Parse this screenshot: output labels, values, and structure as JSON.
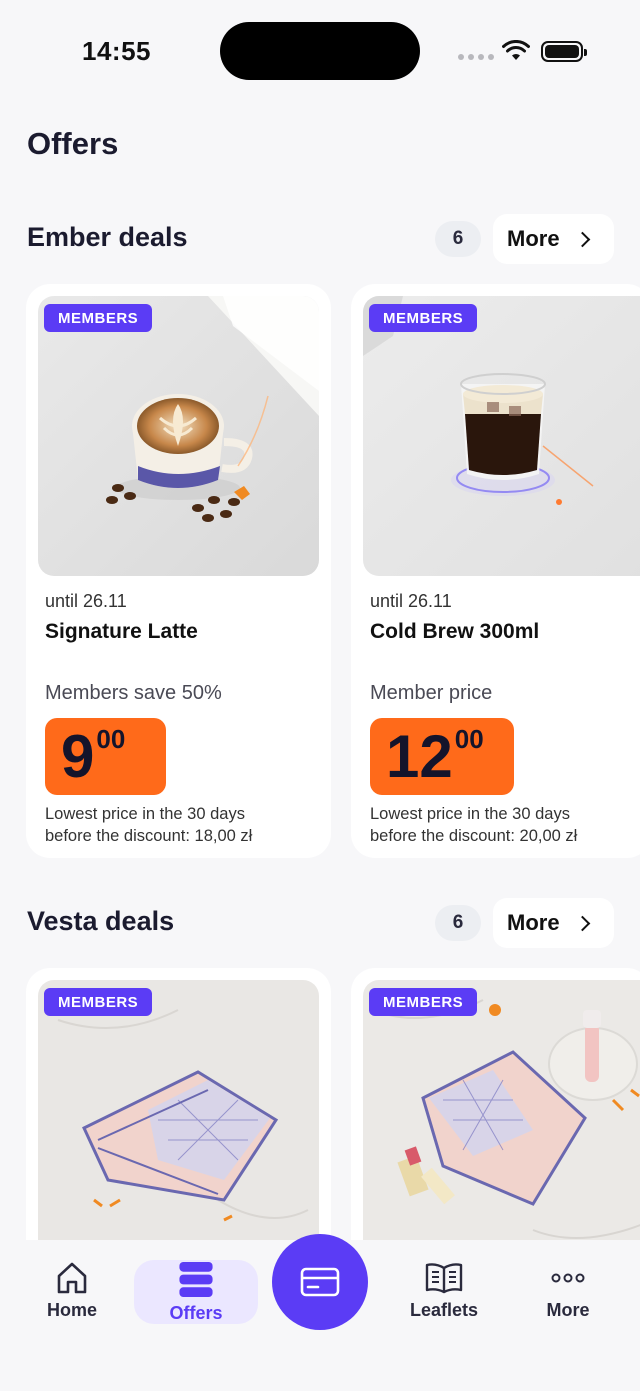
{
  "status_bar": {
    "time": "14:55"
  },
  "page": {
    "title": "Offers"
  },
  "sections": [
    {
      "title": "Ember deals",
      "count": "6",
      "more_label": "More",
      "cards": [
        {
          "badge": "MEMBERS",
          "valid_until": "until 26.11",
          "name": "Signature Latte",
          "promo": "Members save 50%",
          "price_main": "9",
          "price_cents": "00",
          "lowest_line1": "Lowest price in the 30 days",
          "lowest_line2": "before the discount: 18,00 zł"
        },
        {
          "badge": "MEMBERS",
          "valid_until": "until 26.11",
          "name": "Cold Brew 300ml",
          "promo": "Member price",
          "price_main": "12",
          "price_cents": "00",
          "lowest_line1": "Lowest price in the 30 days",
          "lowest_line2": "before the discount: 20,00 zł"
        }
      ]
    },
    {
      "title": "Vesta deals",
      "count": "6",
      "more_label": "More",
      "cards": [
        {
          "badge": "MEMBERS"
        },
        {
          "badge": "MEMBERS"
        }
      ]
    }
  ],
  "nav": {
    "items": [
      {
        "label": "Home",
        "icon": "house-icon"
      },
      {
        "label": "Offers",
        "icon": "stack-icon",
        "active": true
      },
      {
        "label": "Leaflets",
        "icon": "open-book-icon"
      },
      {
        "label": "More",
        "icon": "dots-icon"
      }
    ],
    "center_icon": "card-icon"
  },
  "colors": {
    "accent": "#5b3cf5",
    "price_tag": "#ff6a1a",
    "background": "#f7f7f9"
  }
}
